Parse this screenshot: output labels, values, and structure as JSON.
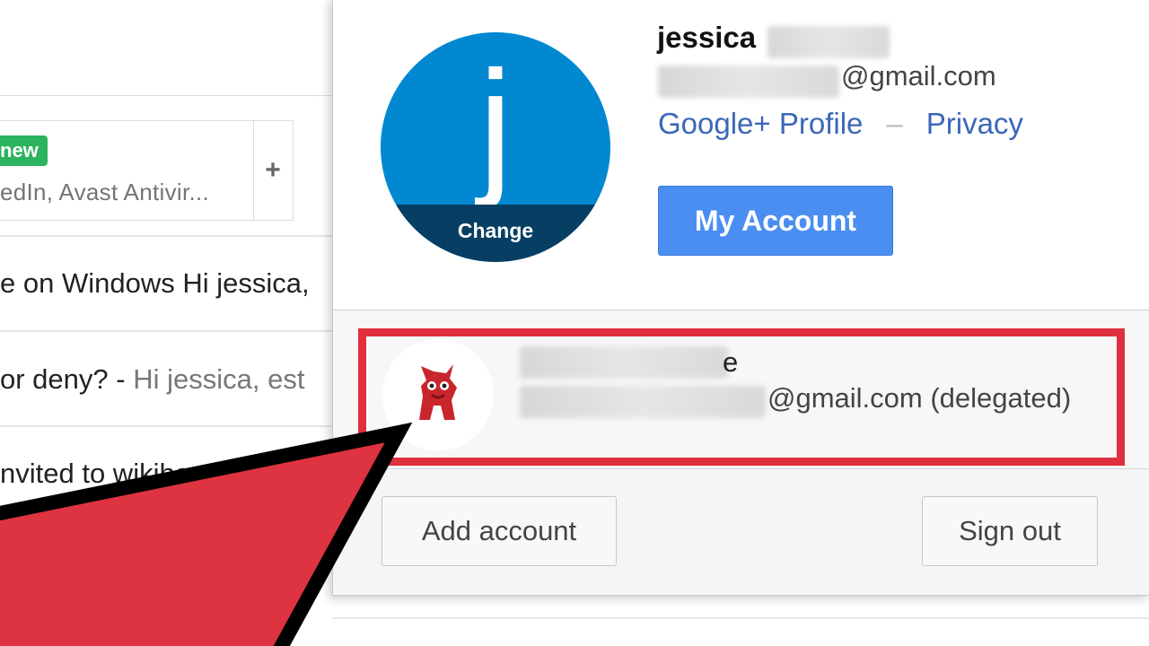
{
  "inbox": {
    "badge_new": "new",
    "tab_subtext": "edIn, Avast Antivir...",
    "add_tab_label": "+",
    "rows": [
      {
        "sender_subject": "e on Windows Hi jessica, ",
        "snippet": ""
      },
      {
        "sender_subject": "or deny? - ",
        "snippet": "Hi jessica, est"
      },
      {
        "sender_subject": "nvited to wikihow",
        "snippet": ""
      }
    ]
  },
  "account_popup": {
    "avatar_letter": "j",
    "avatar_color": "#0288d1",
    "change_label": "Change",
    "name": "jessica",
    "email_suffix": "@gmail.com",
    "google_plus_link": "Google+ Profile",
    "separator": "–",
    "privacy_link": "Privacy",
    "my_account_button": "My Account",
    "delegated_account": {
      "name_tail": "e",
      "email_suffix": "@gmail.com (delegated)",
      "avatar_icon": "red-mascot-icon"
    },
    "add_account_button": "Add account",
    "sign_out_button": "Sign out"
  },
  "annotation": {
    "highlight_color": "#e0303e",
    "arrow_color": "#e0303e",
    "arrow_icon": "pointer-arrow-icon"
  }
}
